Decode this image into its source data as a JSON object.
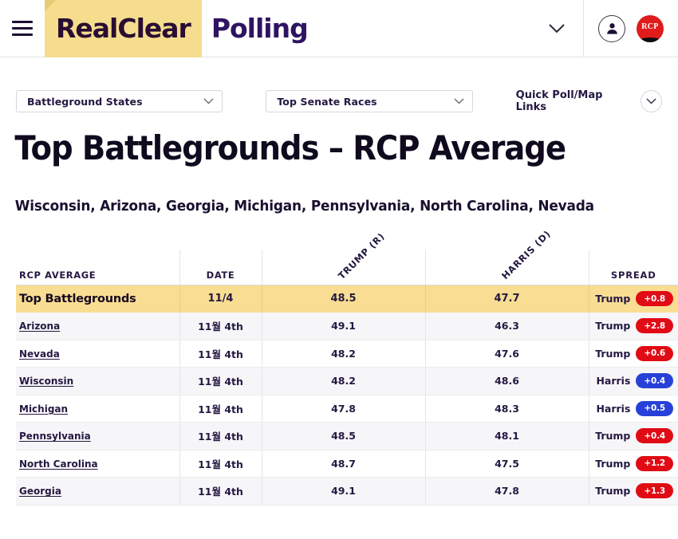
{
  "header": {
    "menu_icon": "hamburger-icon",
    "brand_primary": "RealClear",
    "brand_secondary": "Polling",
    "chevron_icon": "chevron-down-icon",
    "account_icon": "user-avatar-icon",
    "logo_text": "RCP",
    "brand_bg": "#f5dd8d"
  },
  "controls": {
    "state_select": "Battleground States",
    "race_select": "Top Senate Races",
    "quick_links": "Quick Poll/Map Links",
    "chevron_icon": "chevron-down-icon"
  },
  "page": {
    "title": "Top Battlegrounds – RCP Average",
    "subtitle": "Wisconsin, Arizona, Georgia, Michigan, Pennsylvania, North Carolina, Nevada"
  },
  "table": {
    "headers": {
      "rcp_average": "RCP AVERAGE",
      "date": "DATE",
      "trump": "TRUMP (R)",
      "harris": "HARRIS (D)",
      "spread": "SPREAD"
    },
    "summary_row": {
      "name": "Top Battlegrounds",
      "date": "11/4",
      "trump": "48.5",
      "harris": "47.7",
      "spread_name": "Trump",
      "spread_value": "+0.8",
      "spread_party": "rep"
    },
    "rows": [
      {
        "name": "Arizona",
        "date": "11월 4th",
        "trump": "49.1",
        "harris": "46.3",
        "spread_name": "Trump",
        "spread_value": "+2.8",
        "spread_party": "rep"
      },
      {
        "name": "Nevada",
        "date": "11월 4th",
        "trump": "48.2",
        "harris": "47.6",
        "spread_name": "Trump",
        "spread_value": "+0.6",
        "spread_party": "rep"
      },
      {
        "name": "Wisconsin",
        "date": "11월 4th",
        "trump": "48.2",
        "harris": "48.6",
        "spread_name": "Harris",
        "spread_value": "+0.4",
        "spread_party": "dem"
      },
      {
        "name": "Michigan",
        "date": "11월 4th",
        "trump": "47.8",
        "harris": "48.3",
        "spread_name": "Harris",
        "spread_value": "+0.5",
        "spread_party": "dem"
      },
      {
        "name": "Pennsylvania",
        "date": "11월 4th",
        "trump": "48.5",
        "harris": "48.1",
        "spread_name": "Trump",
        "spread_value": "+0.4",
        "spread_party": "rep"
      },
      {
        "name": "North Carolina",
        "date": "11월 4th",
        "trump": "48.7",
        "harris": "47.5",
        "spread_name": "Trump",
        "spread_value": "+1.2",
        "spread_party": "rep"
      },
      {
        "name": "Georgia",
        "date": "11월 4th",
        "trump": "49.1",
        "harris": "47.8",
        "spread_name": "Trump",
        "spread_value": "+1.3",
        "spread_party": "rep"
      }
    ]
  },
  "colors": {
    "republican": "#e00b14",
    "democrat": "#2741d8",
    "highlight": "#f9dd92"
  }
}
